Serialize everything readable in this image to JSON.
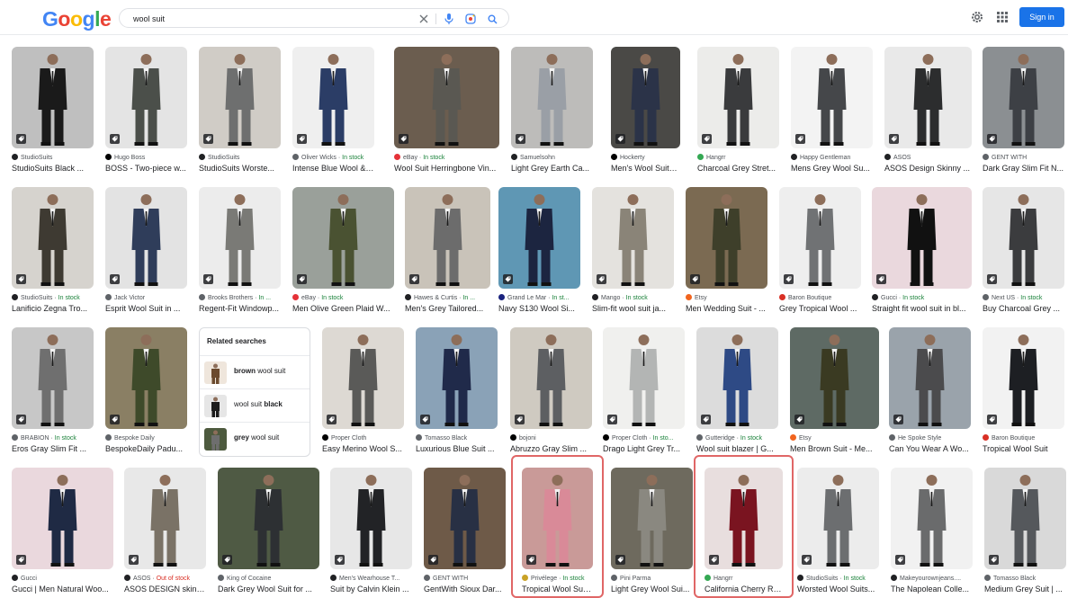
{
  "header": {
    "logo": "Google",
    "search_value": "wool suit",
    "icons": [
      "clear-icon",
      "mic-icon",
      "lens-icon",
      "search-icon",
      "settings-icon",
      "apps-icon"
    ],
    "signin_label": "Sign in"
  },
  "logo_colors": [
    "#4285f4",
    "#ea4335",
    "#fbbc05",
    "#4285f4",
    "#34a853",
    "#ea4335"
  ],
  "related": {
    "title": "Related searches",
    "items": [
      {
        "pre": "",
        "bold": "brown",
        "post": " wool suit"
      },
      {
        "pre": "wool suit ",
        "bold": "black",
        "post": ""
      },
      {
        "pre": "",
        "bold": "grey",
        "post": " wool suit"
      }
    ]
  },
  "results": [
    [
      {
        "source": "StudioSuits",
        "stock": "",
        "title": "StudioSuits Black ...",
        "favicon": "#202124",
        "bg": "#bfbfbf",
        "suit": "#1a1a1a"
      },
      {
        "source": "Hugo Boss",
        "stock": "",
        "title": "BOSS - Two-piece w...",
        "favicon": "#000000",
        "bg": "#e4e4e4",
        "suit": "#4b4f4a"
      },
      {
        "source": "StudioSuits",
        "stock": "",
        "title": "StudioSuits Worste...",
        "favicon": "#202124",
        "bg": "#d0ccc6",
        "suit": "#6e6f6f"
      },
      {
        "source": "Oliver Wicks",
        "stock": "In stock",
        "title": "Intense Blue Wool & ...",
        "favicon": "#5f6368",
        "bg": "#efefef",
        "suit": "#2b3d66"
      },
      {
        "source": "eBay",
        "stock": "In stock",
        "title": "Wool Suit Herringbone Vin...",
        "favicon": "#e53238",
        "bg": "#6b5d4f",
        "suit": "#5a5852"
      },
      {
        "source": "Samuelsohn",
        "stock": "",
        "title": "Light Grey Earth Ca...",
        "favicon": "#202124",
        "bg": "#bdbcba",
        "suit": "#9a9fa6"
      },
      {
        "source": "Hockerty",
        "stock": "",
        "title": "Men's Wool Suits O...",
        "favicon": "#000000",
        "bg": "#4a4946",
        "suit": "#2b3348"
      },
      {
        "source": "Hangrr",
        "stock": "",
        "title": "Charcoal Grey Stret...",
        "favicon": "#34a853",
        "bg": "#ececea",
        "suit": "#3a3b3d"
      },
      {
        "source": "Happy Gentleman",
        "stock": "",
        "title": "Mens Grey Wool Su...",
        "favicon": "#202124",
        "bg": "#f3f3f3",
        "suit": "#45474a"
      },
      {
        "source": "ASOS",
        "stock": "",
        "title": "ASOS Design Skinny ...",
        "favicon": "#202124",
        "bg": "#e9e9e9",
        "suit": "#2c2d2e"
      },
      {
        "source": "GENT WITH",
        "stock": "",
        "title": "Dark Gray Slim Fit N...",
        "favicon": "#5f6368",
        "bg": "#8b8f92",
        "suit": "#3d4045"
      }
    ],
    [
      {
        "source": "StudioSuits",
        "stock": "In stock",
        "title": "Lanificio Zegna Tro...",
        "favicon": "#202124",
        "bg": "#d6d3ce",
        "suit": "#3e3a32"
      },
      {
        "source": "Jack Victor",
        "stock": "",
        "title": "Esprit Wool Suit in ...",
        "favicon": "#5f6368",
        "bg": "#e3e3e3",
        "suit": "#2f3d5a"
      },
      {
        "source": "Brooks Brothers",
        "stock": "In ...",
        "title": "Regent-Fit Windowp...",
        "favicon": "#5f6368",
        "bg": "#ececec",
        "suit": "#7a7a76"
      },
      {
        "source": "eBay",
        "stock": "In stock",
        "title": "Men Olive Green Plaid W...",
        "favicon": "#e53238",
        "bg": "#9aa09a",
        "suit": "#4a5232"
      },
      {
        "source": "Hawes & Curtis",
        "stock": "In ...",
        "title": "Men's Grey Tailored...",
        "favicon": "#202124",
        "bg": "#c9c3b9",
        "suit": "#6c6c6c"
      },
      {
        "source": "Grand Le Mar",
        "stock": "In st...",
        "title": "Navy S130 Wool Si...",
        "favicon": "#1a237e",
        "bg": "#5f97b4",
        "suit": "#1c2540"
      },
      {
        "source": "Mango",
        "stock": "In stock",
        "title": "Slim-fit wool suit ja...",
        "favicon": "#202124",
        "bg": "#e4e2de",
        "suit": "#8a8478"
      },
      {
        "source": "Etsy",
        "stock": "",
        "title": "Men Wedding Suit - ...",
        "favicon": "#f1641e",
        "bg": "#7b6a52",
        "suit": "#3e3f2a"
      },
      {
        "source": "Baron Boutique",
        "stock": "",
        "title": "Grey Tropical Wool ...",
        "favicon": "#d93025",
        "bg": "#eeeeee",
        "suit": "#707274"
      },
      {
        "source": "Gucci",
        "stock": "In stock",
        "title": "Straight fit wool suit in bl...",
        "favicon": "#202124",
        "bg": "#ead8dd",
        "suit": "#111111"
      },
      {
        "source": "Next US",
        "stock": "In stock",
        "title": "Buy Charcoal Grey ...",
        "favicon": "#5f6368",
        "bg": "#e6e6e6",
        "suit": "#3b3c3e"
      }
    ],
    [
      {
        "source": "BRABION",
        "stock": "In stock",
        "title": "Eros Gray Slim Fit ...",
        "favicon": "#5f6368",
        "bg": "#c7c7c7",
        "suit": "#6f6f6f"
      },
      {
        "source": "Bespoke Daily",
        "stock": "",
        "title": "BespokeDaily Padu...",
        "favicon": "#5f6368",
        "bg": "#8a7f64",
        "suit": "#3e4a2a"
      },
      null,
      {
        "source": "Proper Cloth",
        "stock": "",
        "title": "Easy Merino Wool S...",
        "favicon": "#000000",
        "bg": "#ddd9d3",
        "suit": "#5a5a58"
      },
      {
        "source": "Tomasso Black",
        "stock": "",
        "title": "Luxurious Blue Suit ...",
        "favicon": "#5f6368",
        "bg": "#8aa2b7",
        "suit": "#202a4a"
      },
      {
        "source": "bojoni",
        "stock": "",
        "title": "Abruzzo Gray Slim ...",
        "favicon": "#000000",
        "bg": "#cfcac1",
        "suit": "#5d5f62"
      },
      {
        "source": "Proper Cloth",
        "stock": "In sto...",
        "title": "Drago Light Grey Tr...",
        "favicon": "#000000",
        "bg": "#f0f0ee",
        "suit": "#b3b5b4"
      },
      {
        "source": "Gutteridge",
        "stock": "In stock",
        "title": "Wool suit blazer | G...",
        "favicon": "#5f6368",
        "bg": "#dcdcdc",
        "suit": "#2e4a85"
      },
      {
        "source": "Etsy",
        "stock": "",
        "title": "Men Brown Suit - Me...",
        "favicon": "#f1641e",
        "bg": "#5e6a64",
        "suit": "#3a3a22"
      },
      {
        "source": "He Spoke Style",
        "stock": "",
        "title": "Can You Wear A Wo...",
        "favicon": "#5f6368",
        "bg": "#9aa3ab",
        "suit": "#4b4b4d"
      },
      {
        "source": "Baron Boutique",
        "stock": "",
        "title": "Tropical Wool Suit",
        "favicon": "#d93025",
        "bg": "#f2f2f2",
        "suit": "#1d1f23"
      }
    ],
    [
      {
        "source": "Gucci",
        "stock": "",
        "title": "Gucci | Men Natural Woo...",
        "favicon": "#202124",
        "bg": "#ead8dd",
        "suit": "#1f2a44"
      },
      {
        "source": "ASOS",
        "stock": "Out of stock",
        "oos": true,
        "title": "ASOS DESIGN skinn...",
        "favicon": "#202124",
        "bg": "#e8e8e8",
        "suit": "#7a7266"
      },
      {
        "source": "King of Cocaine",
        "stock": "",
        "title": "Dark Grey Wool Suit for ...",
        "favicon": "#5f6368",
        "bg": "#4f5a44",
        "suit": "#2d3033"
      },
      {
        "source": "Men's Wearhouse T...",
        "stock": "",
        "title": "Suit by Calvin Klein ...",
        "favicon": "#202124",
        "bg": "#e7e7e7",
        "suit": "#222326"
      },
      {
        "source": "GENT WITH",
        "stock": "",
        "title": "GentWith Sioux Dar...",
        "favicon": "#5f6368",
        "bg": "#6e5a48",
        "suit": "#283044"
      },
      {
        "source": "Privélege",
        "stock": "In stock",
        "title": "Tropical Wool Suit - ...",
        "favicon": "#c9a227",
        "bg": "#c99a98",
        "suit": "#d98a98",
        "highlight": true
      },
      {
        "source": "Pini Parma",
        "stock": "",
        "title": "Light Grey Wool Sui...",
        "favicon": "#5f6368",
        "bg": "#6e6a5e",
        "suit": "#8a8880"
      },
      {
        "source": "Hangrr",
        "stock": "",
        "title": "California Cherry Re...",
        "favicon": "#34a853",
        "bg": "#e8dede",
        "suit": "#7a1420",
        "highlight": true
      },
      {
        "source": "StudioSuits",
        "stock": "In stock",
        "title": "Worsted Wool Suits...",
        "favicon": "#202124",
        "bg": "#ececec",
        "suit": "#6c6e70"
      },
      {
        "source": "Makeyourownjeans....",
        "stock": "",
        "title": "The Napolean Colle...",
        "favicon": "#202124",
        "bg": "#f1f1f1",
        "suit": "#6a6b6c"
      },
      {
        "source": "Tomasso Black",
        "stock": "",
        "title": "Medium Grey Suit | ...",
        "favicon": "#5f6368",
        "bg": "#d9d9d9",
        "suit": "#55585c"
      }
    ]
  ]
}
